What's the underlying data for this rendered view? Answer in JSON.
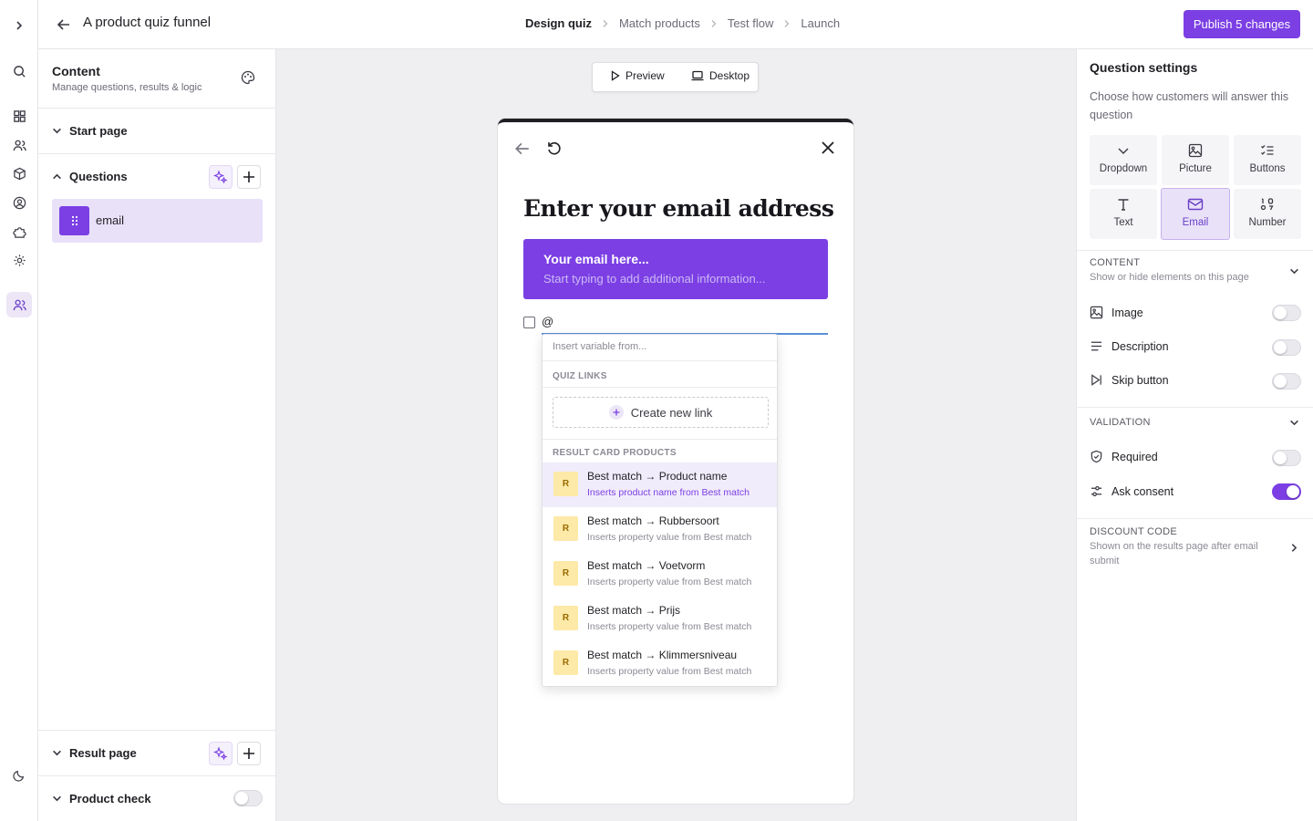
{
  "app": {
    "title": "A product quiz funnel",
    "publish_label": "Publish 5 changes"
  },
  "steps": [
    {
      "label": "Design quiz",
      "active": true
    },
    {
      "label": "Match products",
      "active": false
    },
    {
      "label": "Test flow",
      "active": false
    },
    {
      "label": "Launch",
      "active": false
    }
  ],
  "content_panel": {
    "title": "Content",
    "subtitle": "Manage questions, results & logic",
    "sections": {
      "start_page": "Start page",
      "questions": "Questions",
      "result_page": "Result page",
      "product_check": "Product check"
    },
    "questions": [
      {
        "label": "email"
      }
    ],
    "product_check_enabled": false
  },
  "view_bar": {
    "preview": "Preview",
    "desktop": "Desktop"
  },
  "quiz": {
    "title": "Enter your email address",
    "email_placeholder": "Your email here...",
    "email_hint": "Start typing to add additional information...",
    "consent_text": "@"
  },
  "dropdown": {
    "search_placeholder": "Insert variable from...",
    "quiz_links_head": "QUIZ LINKS",
    "create_link": "Create new link",
    "result_head": "RESULT CARD PRODUCTS",
    "items": [
      {
        "badge": "R",
        "title": "Best match → Product name",
        "sub": "Inserts product name from Best match"
      },
      {
        "badge": "R",
        "title": "Best match → Rubbersoort",
        "sub": "Inserts property value from Best match"
      },
      {
        "badge": "R",
        "title": "Best match → Voetvorm",
        "sub": "Inserts property value from Best match"
      },
      {
        "badge": "R",
        "title": "Best match → Prijs",
        "sub": "Inserts property value from Best match"
      },
      {
        "badge": "R",
        "title": "Best match → Klimmersniveau",
        "sub": "Inserts property value from Best match"
      }
    ]
  },
  "settings": {
    "title": "Question settings",
    "subtitle": "Choose how customers will answer this question",
    "types": [
      {
        "label": "Dropdown",
        "icon": "chevron-down-icon"
      },
      {
        "label": "Picture",
        "icon": "image-icon"
      },
      {
        "label": "Buttons",
        "icon": "list-check-icon"
      },
      {
        "label": "Text",
        "icon": "text-icon"
      },
      {
        "label": "Email",
        "icon": "mail-icon",
        "selected": true
      },
      {
        "label": "Number",
        "icon": "number-icon"
      }
    ],
    "content_head": "CONTENT",
    "content_sub": "Show or hide elements on this page",
    "image_label": "Image",
    "description_label": "Description",
    "skip_label": "Skip button",
    "validation_head": "VALIDATION",
    "required_label": "Required",
    "consent_label": "Ask consent",
    "discount_head": "DISCOUNT CODE",
    "discount_sub": "Shown on the results page after email submit",
    "toggles": {
      "image": false,
      "description": false,
      "skip_button": false,
      "required": false,
      "ask_consent": true
    }
  },
  "colors": {
    "accent": "#7b3fe4",
    "badge": "#fde9a8"
  }
}
